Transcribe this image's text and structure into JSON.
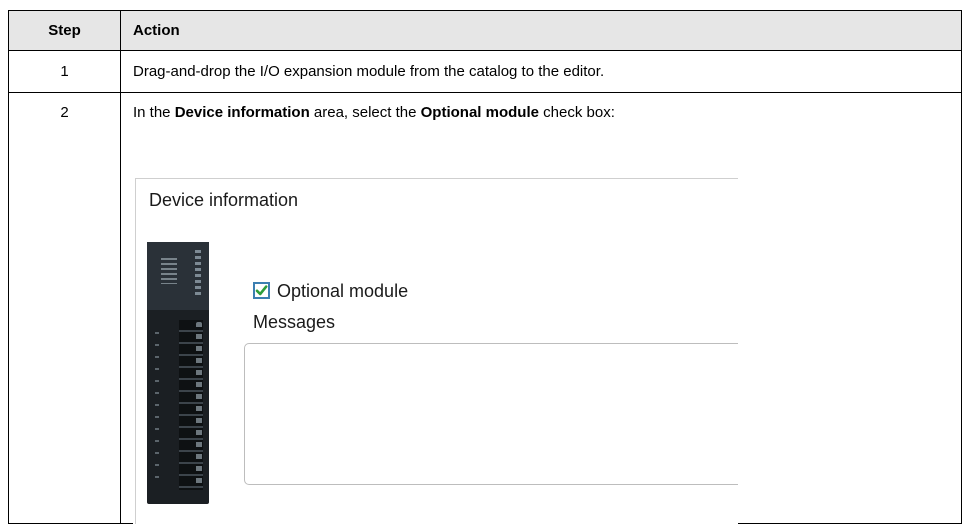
{
  "table": {
    "headers": {
      "step": "Step",
      "action": "Action"
    },
    "rows": [
      {
        "step": "1",
        "action": "Drag-and-drop the I/O expansion module from the catalog to the editor."
      },
      {
        "step": "2",
        "action_parts": {
          "pre": "In the ",
          "bold1": "Device information",
          "mid": " area, select the ",
          "bold2": "Optional module",
          "post": " check box:"
        }
      }
    ]
  },
  "screenshot": {
    "section_title": "Device information",
    "checkbox": {
      "label": "Optional module",
      "checked": true
    },
    "messages_label": "Messages",
    "messages_value": "",
    "check_color": "#2e9e3b",
    "checkbox_border_color": "#3c7fb1",
    "module_image": "io-expansion-module-image"
  }
}
